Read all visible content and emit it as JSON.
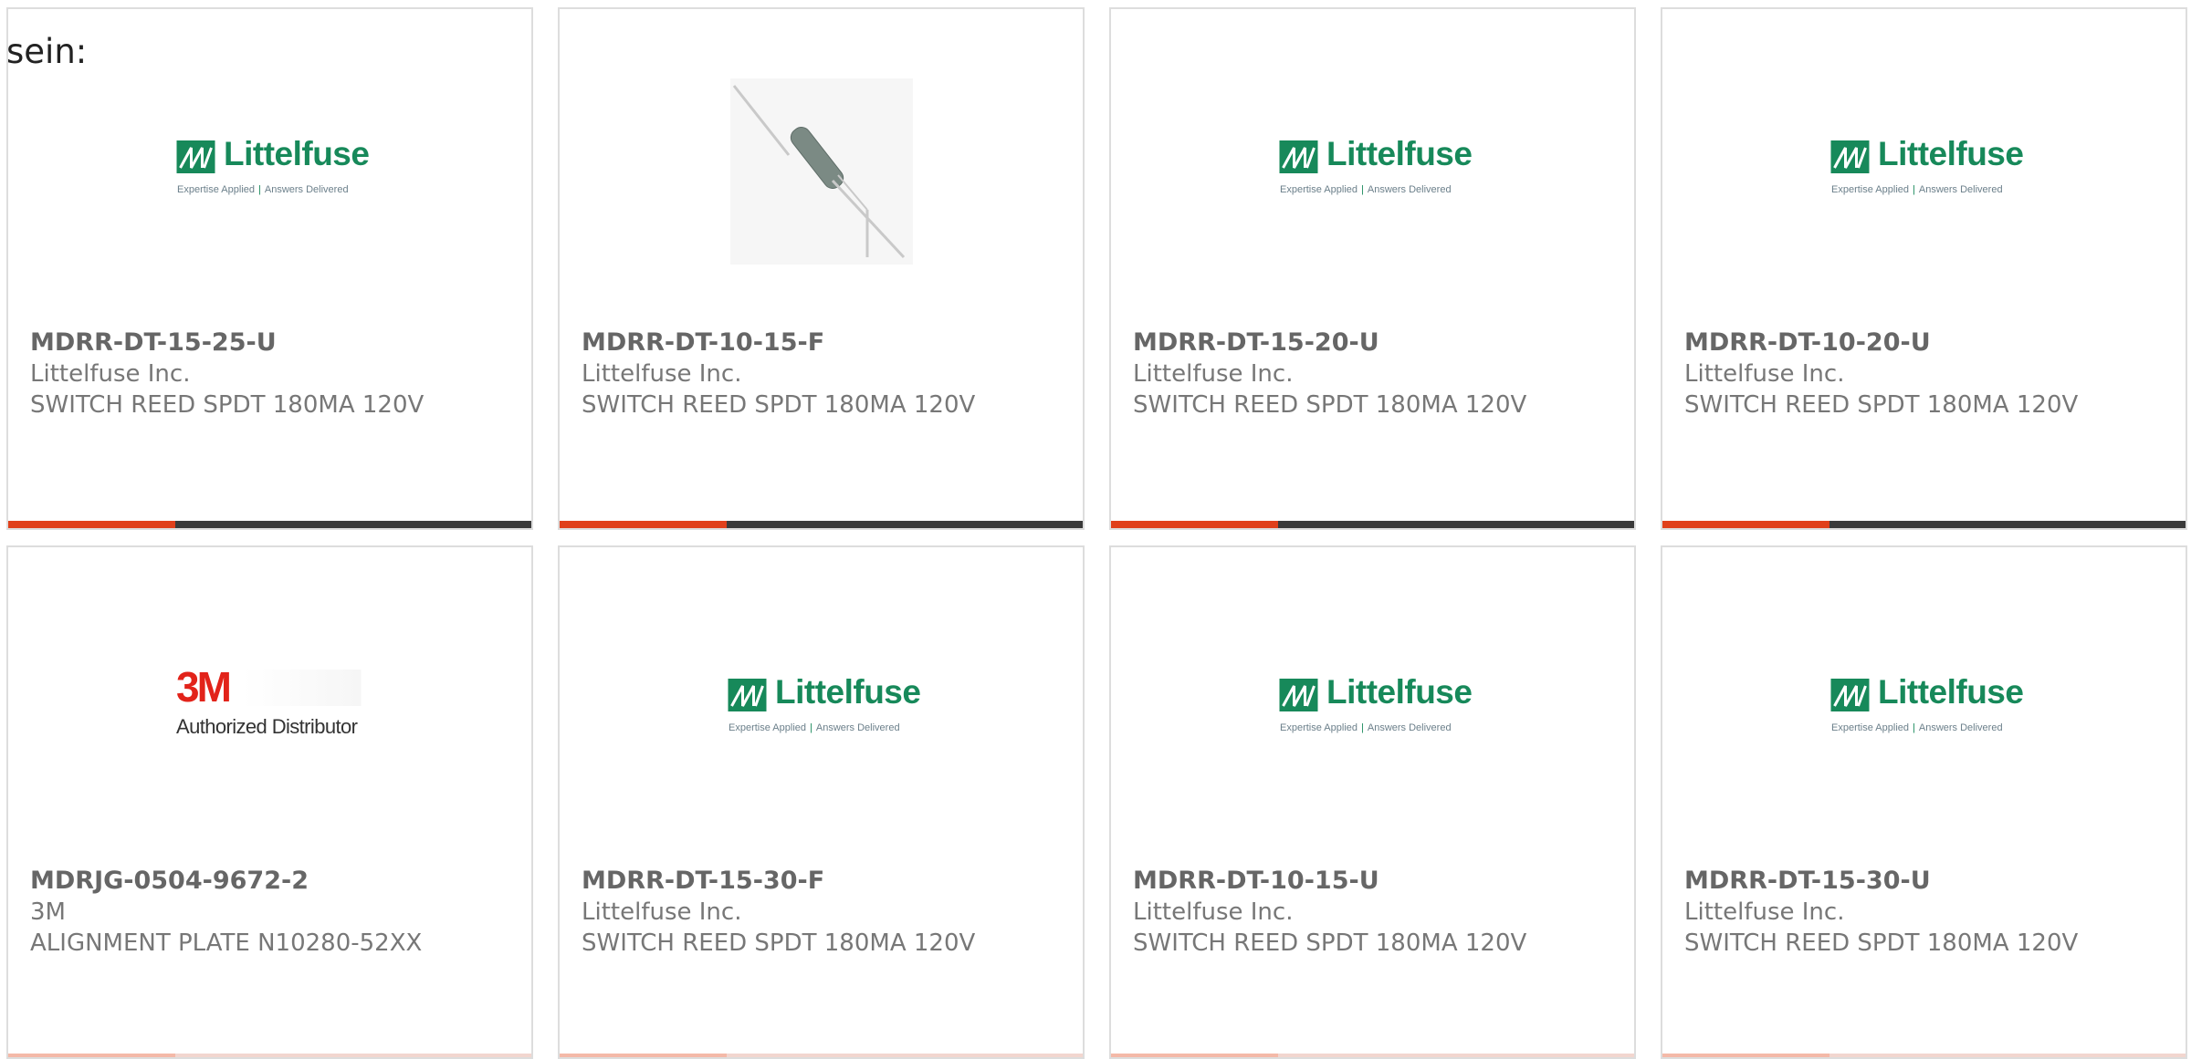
{
  "lead_text": "sein:",
  "colors": {
    "card_border": "#dddddd",
    "part_number": "#666666",
    "secondary_text": "#777777",
    "bar_dark": "#3a3a3a",
    "bar_accent": "#e0401b",
    "littelfuse_green": "#17895a",
    "threem_red": "#e2231a"
  },
  "logos": {
    "littelfuse": {
      "name": "Littelfuse",
      "tagline_left": "Expertise Applied",
      "tagline_sep": "|",
      "tagline_right": "Answers Delivered"
    },
    "threem": {
      "mark": "3M",
      "text": "Authorized Distributor"
    }
  },
  "products": [
    {
      "part_number": "MDRR-DT-15-25-U",
      "manufacturer": "Littelfuse Inc.",
      "description": "SWITCH REED SPDT 180MA 120V",
      "image": "littelfuse-logo"
    },
    {
      "part_number": "MDRR-DT-10-15-F",
      "manufacturer": "Littelfuse Inc.",
      "description": "SWITCH REED SPDT 180MA 120V",
      "image": "reed-switch-photo"
    },
    {
      "part_number": "MDRR-DT-15-20-U",
      "manufacturer": "Littelfuse Inc.",
      "description": "SWITCH REED SPDT 180MA 120V",
      "image": "littelfuse-logo"
    },
    {
      "part_number": "MDRR-DT-10-20-U",
      "manufacturer": "Littelfuse Inc.",
      "description": "SWITCH REED SPDT 180MA 120V",
      "image": "littelfuse-logo"
    },
    {
      "part_number": "MDRJG-0504-9672-2",
      "manufacturer": "3M",
      "description": "ALIGNMENT PLATE N10280-52XX",
      "image": "3m-logo"
    },
    {
      "part_number": "MDRR-DT-15-30-F",
      "manufacturer": "Littelfuse Inc.",
      "description": "SWITCH REED SPDT 180MA 120V",
      "image": "littelfuse-logo"
    },
    {
      "part_number": "MDRR-DT-10-15-U",
      "manufacturer": "Littelfuse Inc.",
      "description": "SWITCH REED SPDT 180MA 120V",
      "image": "littelfuse-logo"
    },
    {
      "part_number": "MDRR-DT-15-30-U",
      "manufacturer": "Littelfuse Inc.",
      "description": "SWITCH REED SPDT 180MA 120V",
      "image": "littelfuse-logo"
    }
  ]
}
